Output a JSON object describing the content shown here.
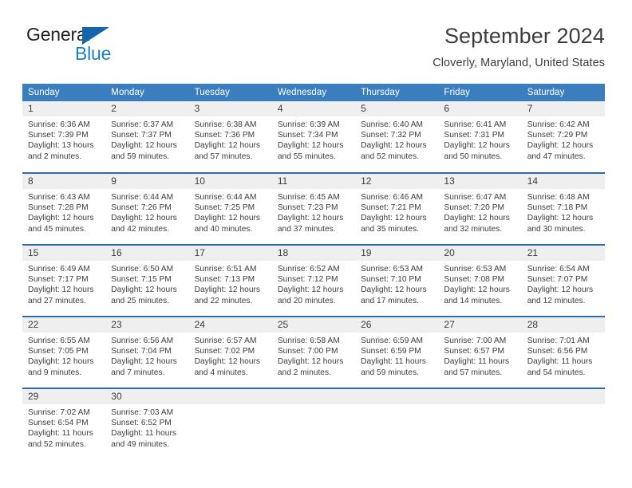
{
  "brand": {
    "name_top": "General",
    "name_bottom": "Blue",
    "accent_color": "#1f7fc4",
    "triangle_color": "#1565ad"
  },
  "header": {
    "title": "September 2024",
    "subtitle": "Cloverly, Maryland, United States"
  },
  "theme": {
    "header_row_bg": "#3b7ebf",
    "row_border": "#2c6ca8",
    "daynum_bg": "#efefef",
    "text": "#3d3d3d"
  },
  "weekdays": [
    "Sunday",
    "Monday",
    "Tuesday",
    "Wednesday",
    "Thursday",
    "Friday",
    "Saturday"
  ],
  "labels": {
    "sunrise": "Sunrise:",
    "sunset": "Sunset:",
    "daylight": "Daylight:"
  },
  "weeks": [
    [
      {
        "day": "1",
        "sunrise": "Sunrise: 6:36 AM",
        "sunset": "Sunset: 7:39 PM",
        "daylight_line1": "Daylight: 13 hours",
        "daylight_line2": "and 2 minutes."
      },
      {
        "day": "2",
        "sunrise": "Sunrise: 6:37 AM",
        "sunset": "Sunset: 7:37 PM",
        "daylight_line1": "Daylight: 12 hours",
        "daylight_line2": "and 59 minutes."
      },
      {
        "day": "3",
        "sunrise": "Sunrise: 6:38 AM",
        "sunset": "Sunset: 7:36 PM",
        "daylight_line1": "Daylight: 12 hours",
        "daylight_line2": "and 57 minutes."
      },
      {
        "day": "4",
        "sunrise": "Sunrise: 6:39 AM",
        "sunset": "Sunset: 7:34 PM",
        "daylight_line1": "Daylight: 12 hours",
        "daylight_line2": "and 55 minutes."
      },
      {
        "day": "5",
        "sunrise": "Sunrise: 6:40 AM",
        "sunset": "Sunset: 7:32 PM",
        "daylight_line1": "Daylight: 12 hours",
        "daylight_line2": "and 52 minutes."
      },
      {
        "day": "6",
        "sunrise": "Sunrise: 6:41 AM",
        "sunset": "Sunset: 7:31 PM",
        "daylight_line1": "Daylight: 12 hours",
        "daylight_line2": "and 50 minutes."
      },
      {
        "day": "7",
        "sunrise": "Sunrise: 6:42 AM",
        "sunset": "Sunset: 7:29 PM",
        "daylight_line1": "Daylight: 12 hours",
        "daylight_line2": "and 47 minutes."
      }
    ],
    [
      {
        "day": "8",
        "sunrise": "Sunrise: 6:43 AM",
        "sunset": "Sunset: 7:28 PM",
        "daylight_line1": "Daylight: 12 hours",
        "daylight_line2": "and 45 minutes."
      },
      {
        "day": "9",
        "sunrise": "Sunrise: 6:44 AM",
        "sunset": "Sunset: 7:26 PM",
        "daylight_line1": "Daylight: 12 hours",
        "daylight_line2": "and 42 minutes."
      },
      {
        "day": "10",
        "sunrise": "Sunrise: 6:44 AM",
        "sunset": "Sunset: 7:25 PM",
        "daylight_line1": "Daylight: 12 hours",
        "daylight_line2": "and 40 minutes."
      },
      {
        "day": "11",
        "sunrise": "Sunrise: 6:45 AM",
        "sunset": "Sunset: 7:23 PM",
        "daylight_line1": "Daylight: 12 hours",
        "daylight_line2": "and 37 minutes."
      },
      {
        "day": "12",
        "sunrise": "Sunrise: 6:46 AM",
        "sunset": "Sunset: 7:21 PM",
        "daylight_line1": "Daylight: 12 hours",
        "daylight_line2": "and 35 minutes."
      },
      {
        "day": "13",
        "sunrise": "Sunrise: 6:47 AM",
        "sunset": "Sunset: 7:20 PM",
        "daylight_line1": "Daylight: 12 hours",
        "daylight_line2": "and 32 minutes."
      },
      {
        "day": "14",
        "sunrise": "Sunrise: 6:48 AM",
        "sunset": "Sunset: 7:18 PM",
        "daylight_line1": "Daylight: 12 hours",
        "daylight_line2": "and 30 minutes."
      }
    ],
    [
      {
        "day": "15",
        "sunrise": "Sunrise: 6:49 AM",
        "sunset": "Sunset: 7:17 PM",
        "daylight_line1": "Daylight: 12 hours",
        "daylight_line2": "and 27 minutes."
      },
      {
        "day": "16",
        "sunrise": "Sunrise: 6:50 AM",
        "sunset": "Sunset: 7:15 PM",
        "daylight_line1": "Daylight: 12 hours",
        "daylight_line2": "and 25 minutes."
      },
      {
        "day": "17",
        "sunrise": "Sunrise: 6:51 AM",
        "sunset": "Sunset: 7:13 PM",
        "daylight_line1": "Daylight: 12 hours",
        "daylight_line2": "and 22 minutes."
      },
      {
        "day": "18",
        "sunrise": "Sunrise: 6:52 AM",
        "sunset": "Sunset: 7:12 PM",
        "daylight_line1": "Daylight: 12 hours",
        "daylight_line2": "and 20 minutes."
      },
      {
        "day": "19",
        "sunrise": "Sunrise: 6:53 AM",
        "sunset": "Sunset: 7:10 PM",
        "daylight_line1": "Daylight: 12 hours",
        "daylight_line2": "and 17 minutes."
      },
      {
        "day": "20",
        "sunrise": "Sunrise: 6:53 AM",
        "sunset": "Sunset: 7:08 PM",
        "daylight_line1": "Daylight: 12 hours",
        "daylight_line2": "and 14 minutes."
      },
      {
        "day": "21",
        "sunrise": "Sunrise: 6:54 AM",
        "sunset": "Sunset: 7:07 PM",
        "daylight_line1": "Daylight: 12 hours",
        "daylight_line2": "and 12 minutes."
      }
    ],
    [
      {
        "day": "22",
        "sunrise": "Sunrise: 6:55 AM",
        "sunset": "Sunset: 7:05 PM",
        "daylight_line1": "Daylight: 12 hours",
        "daylight_line2": "and 9 minutes."
      },
      {
        "day": "23",
        "sunrise": "Sunrise: 6:56 AM",
        "sunset": "Sunset: 7:04 PM",
        "daylight_line1": "Daylight: 12 hours",
        "daylight_line2": "and 7 minutes."
      },
      {
        "day": "24",
        "sunrise": "Sunrise: 6:57 AM",
        "sunset": "Sunset: 7:02 PM",
        "daylight_line1": "Daylight: 12 hours",
        "daylight_line2": "and 4 minutes."
      },
      {
        "day": "25",
        "sunrise": "Sunrise: 6:58 AM",
        "sunset": "Sunset: 7:00 PM",
        "daylight_line1": "Daylight: 12 hours",
        "daylight_line2": "and 2 minutes."
      },
      {
        "day": "26",
        "sunrise": "Sunrise: 6:59 AM",
        "sunset": "Sunset: 6:59 PM",
        "daylight_line1": "Daylight: 11 hours",
        "daylight_line2": "and 59 minutes."
      },
      {
        "day": "27",
        "sunrise": "Sunrise: 7:00 AM",
        "sunset": "Sunset: 6:57 PM",
        "daylight_line1": "Daylight: 11 hours",
        "daylight_line2": "and 57 minutes."
      },
      {
        "day": "28",
        "sunrise": "Sunrise: 7:01 AM",
        "sunset": "Sunset: 6:56 PM",
        "daylight_line1": "Daylight: 11 hours",
        "daylight_line2": "and 54 minutes."
      }
    ],
    [
      {
        "day": "29",
        "sunrise": "Sunrise: 7:02 AM",
        "sunset": "Sunset: 6:54 PM",
        "daylight_line1": "Daylight: 11 hours",
        "daylight_line2": "and 52 minutes."
      },
      {
        "day": "30",
        "sunrise": "Sunrise: 7:03 AM",
        "sunset": "Sunset: 6:52 PM",
        "daylight_line1": "Daylight: 11 hours",
        "daylight_line2": "and 49 minutes."
      },
      {
        "day": "",
        "sunrise": "",
        "sunset": "",
        "daylight_line1": "",
        "daylight_line2": ""
      },
      {
        "day": "",
        "sunrise": "",
        "sunset": "",
        "daylight_line1": "",
        "daylight_line2": ""
      },
      {
        "day": "",
        "sunrise": "",
        "sunset": "",
        "daylight_line1": "",
        "daylight_line2": ""
      },
      {
        "day": "",
        "sunrise": "",
        "sunset": "",
        "daylight_line1": "",
        "daylight_line2": ""
      },
      {
        "day": "",
        "sunrise": "",
        "sunset": "",
        "daylight_line1": "",
        "daylight_line2": ""
      }
    ]
  ]
}
